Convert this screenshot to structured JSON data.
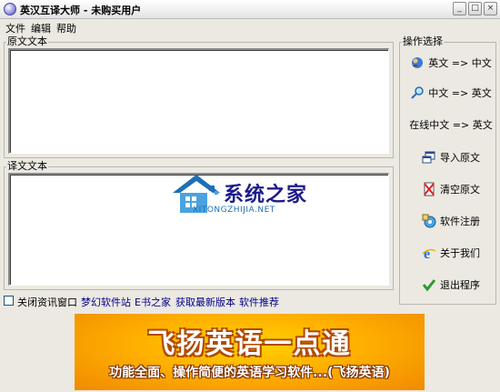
{
  "window": {
    "title": "英汉互译大师 - 未购买用户",
    "minimize": "_",
    "maximize": "□",
    "close": "×"
  },
  "menu": [
    "文件",
    "编辑",
    "帮助"
  ],
  "source_panel": {
    "label": "原文文本"
  },
  "target_panel": {
    "label": "译文文本"
  },
  "operations": {
    "label": "操作选择",
    "buttons": [
      {
        "label": "英文 => 中文",
        "icon": "globe-user-icon"
      },
      {
        "label": "中文 => 英文",
        "icon": "magnifier-icon"
      },
      {
        "label": "在线中文 => 英文",
        "icon": ""
      },
      {
        "label": "导入原文",
        "icon": "import-window-icon"
      },
      {
        "label": "清空原文",
        "icon": "clear-document-icon"
      },
      {
        "label": "软件注册",
        "icon": "register-disc-icon"
      },
      {
        "label": "关于我们",
        "icon": "browser-e-icon"
      },
      {
        "label": "退出程序",
        "icon": "green-check-icon"
      }
    ]
  },
  "bottom_bar": {
    "checkbox_label": "关闭资讯窗口",
    "checkbox_checked": false,
    "links": [
      "梦幻软件站",
      "E书之家",
      "获取最新版本",
      "软件推荐"
    ]
  },
  "ad": {
    "title": "飞扬英语一点通",
    "subtitle": "功能全面、操作简便的英语学习软件...(飞扬英语)"
  },
  "watermark": {
    "brand": "系统之家",
    "domain": "XITONGZHIJIA.NET"
  },
  "colors": {
    "window_bg": "#ece9e2",
    "link": "#00008b",
    "ad_orange": "#ffb000"
  }
}
